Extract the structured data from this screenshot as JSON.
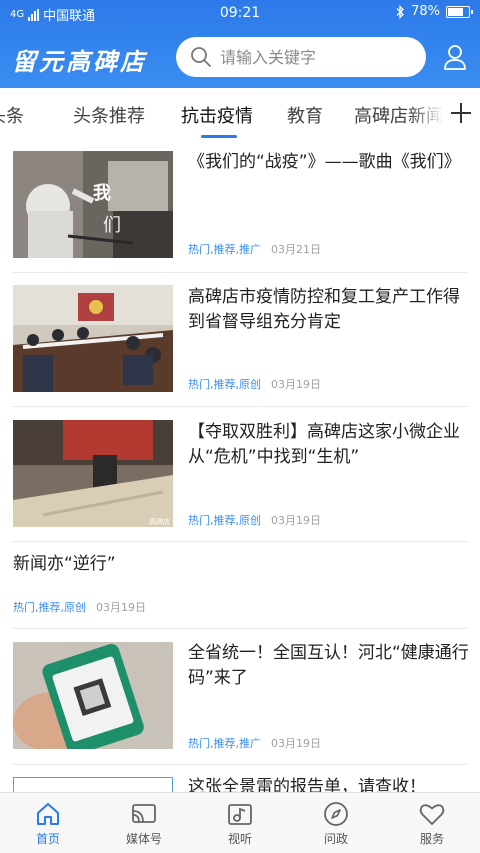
{
  "status_bar": {
    "network_type": "4G",
    "carrier": "中国联通",
    "time": "09:21",
    "battery_text": "78%",
    "battery_level": 0.78
  },
  "app_bar": {
    "logo_text": "留元高碑店",
    "search_placeholder": "请输入关键字",
    "accent_color": "#2c7ae9"
  },
  "tabs": [
    {
      "label": "头条",
      "active": false
    },
    {
      "label": "头条推荐",
      "active": false
    },
    {
      "label": "抗击疫情",
      "active": true
    },
    {
      "label": "教育",
      "active": false
    },
    {
      "label": "高碑店新闻",
      "active": false
    }
  ],
  "news": [
    {
      "title": "《我们的“战疫”》——歌曲《我们》",
      "tags": "热门,推荐,推广",
      "date": "03月21日",
      "has_image": true
    },
    {
      "title": "高碑店市疫情防控和复工复产工作得到省督导组充分肯定",
      "tags": "热门,推荐,原创",
      "date": "03月19日",
      "has_image": true
    },
    {
      "title": "【夺取双胜利】高碑店这家小微企业从“危机”中找到“生机”",
      "tags": "热门,推荐,原创",
      "date": "03月19日",
      "has_image": true
    },
    {
      "title": "新闻亦“逆行”",
      "tags": "热门,推荐,原创",
      "date": "03月19日",
      "has_image": false
    },
    {
      "title": "全省统一！全国互认！河北“健康通行码”来了",
      "tags": "热门,推荐,推广",
      "date": "03月19日",
      "has_image": true
    },
    {
      "title": "这张全景雷的报告单，请查收！",
      "tags": "",
      "date": "",
      "has_image": true
    }
  ],
  "bottom_nav": [
    {
      "label": "首页",
      "icon": "home-icon",
      "active": true
    },
    {
      "label": "媒体号",
      "icon": "cast-icon",
      "active": false
    },
    {
      "label": "视听",
      "icon": "music-video-icon",
      "active": false
    },
    {
      "label": "问政",
      "icon": "compass-icon",
      "active": false
    },
    {
      "label": "服务",
      "icon": "heart-icon",
      "active": false
    }
  ]
}
